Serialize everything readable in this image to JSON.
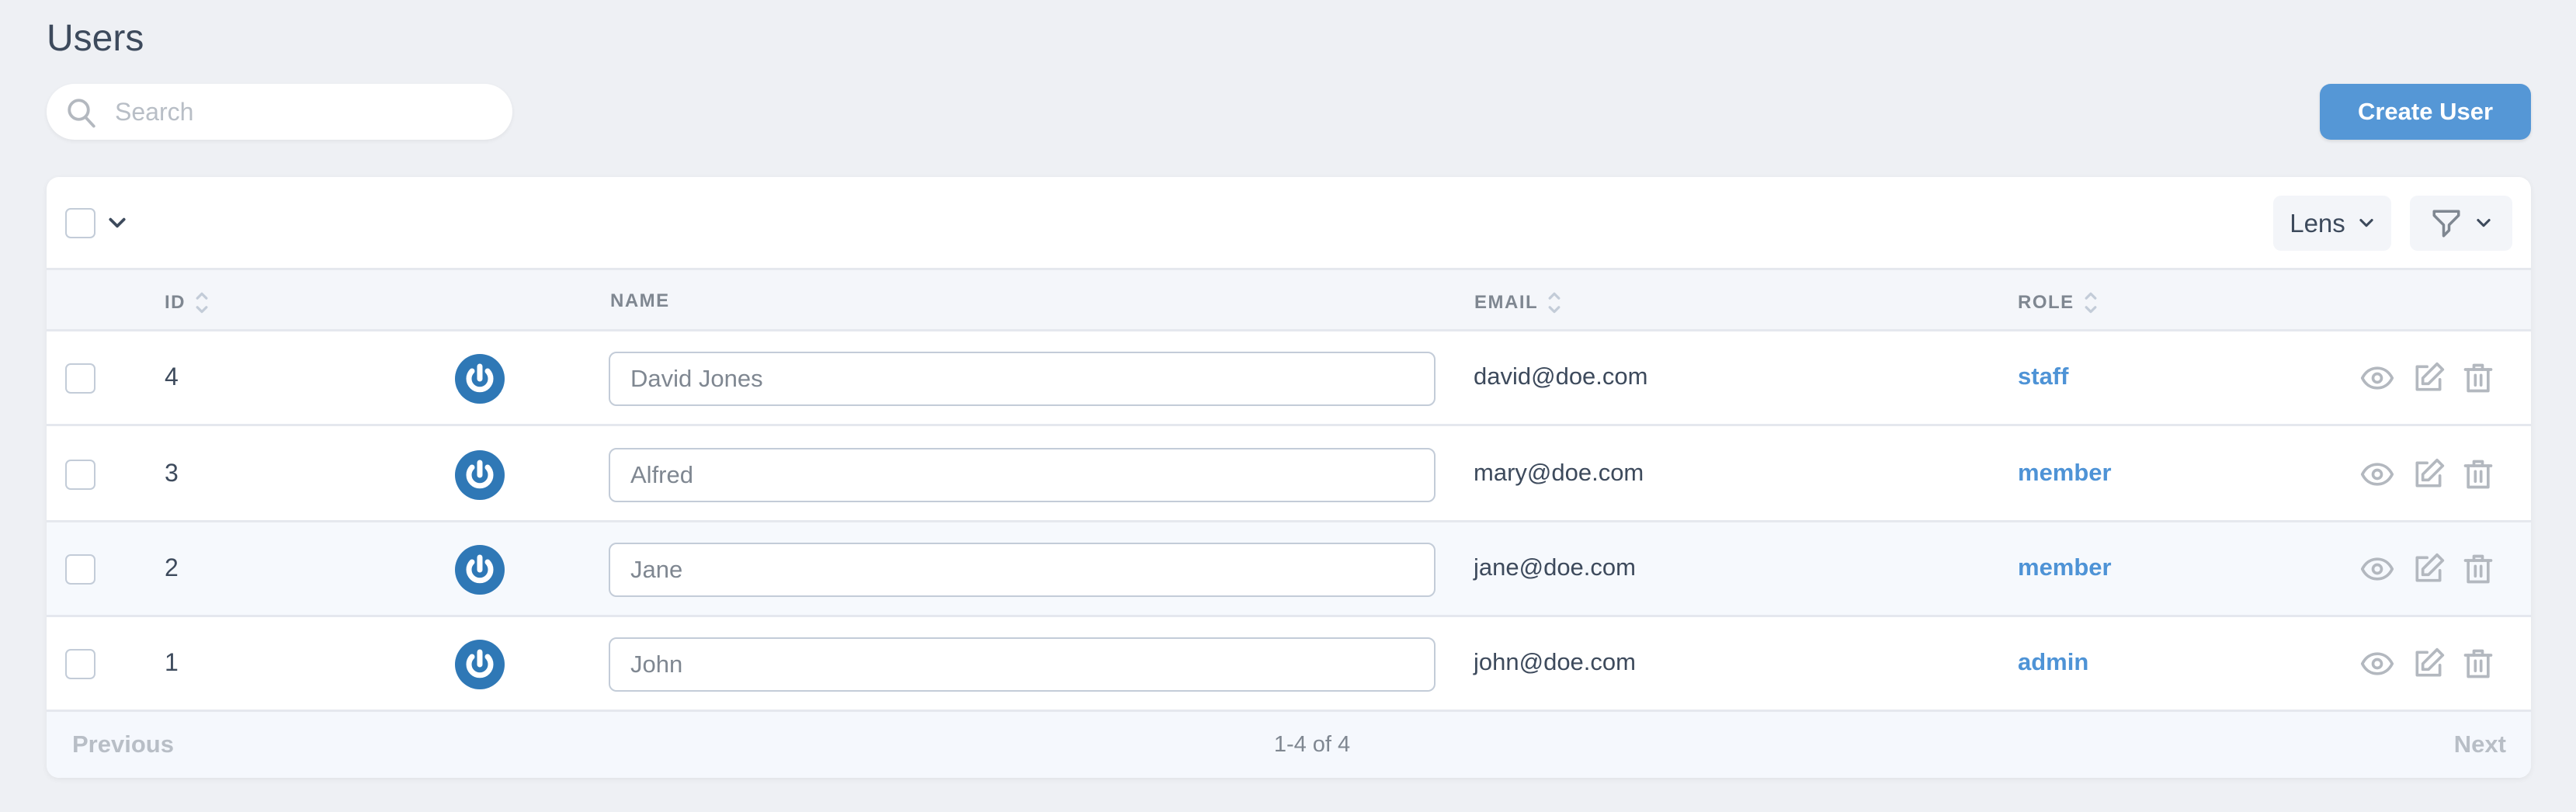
{
  "page": {
    "title": "Users"
  },
  "search": {
    "placeholder": "Search",
    "value": ""
  },
  "actions": {
    "create_label": "Create User"
  },
  "toolbar": {
    "lens_label": "Lens"
  },
  "table": {
    "columns": {
      "id": "ID",
      "name": "NAME",
      "email": "EMAIL",
      "role": "ROLE"
    },
    "rows": [
      {
        "id": "4",
        "name": "David Jones",
        "email": "david@doe.com",
        "role": "staff"
      },
      {
        "id": "3",
        "name": "Alfred",
        "email": "mary@doe.com",
        "role": "member"
      },
      {
        "id": "2",
        "name": "Jane",
        "email": "jane@doe.com",
        "role": "member"
      },
      {
        "id": "1",
        "name": "John",
        "email": "john@doe.com",
        "role": "admin"
      }
    ]
  },
  "pagination": {
    "previous": "Previous",
    "range": "1-4 of 4",
    "next": "Next"
  },
  "colors": {
    "accent": "#5597d6",
    "link": "#4e93d6",
    "avatar": "#2f78b6",
    "background": "#eef0f4"
  }
}
